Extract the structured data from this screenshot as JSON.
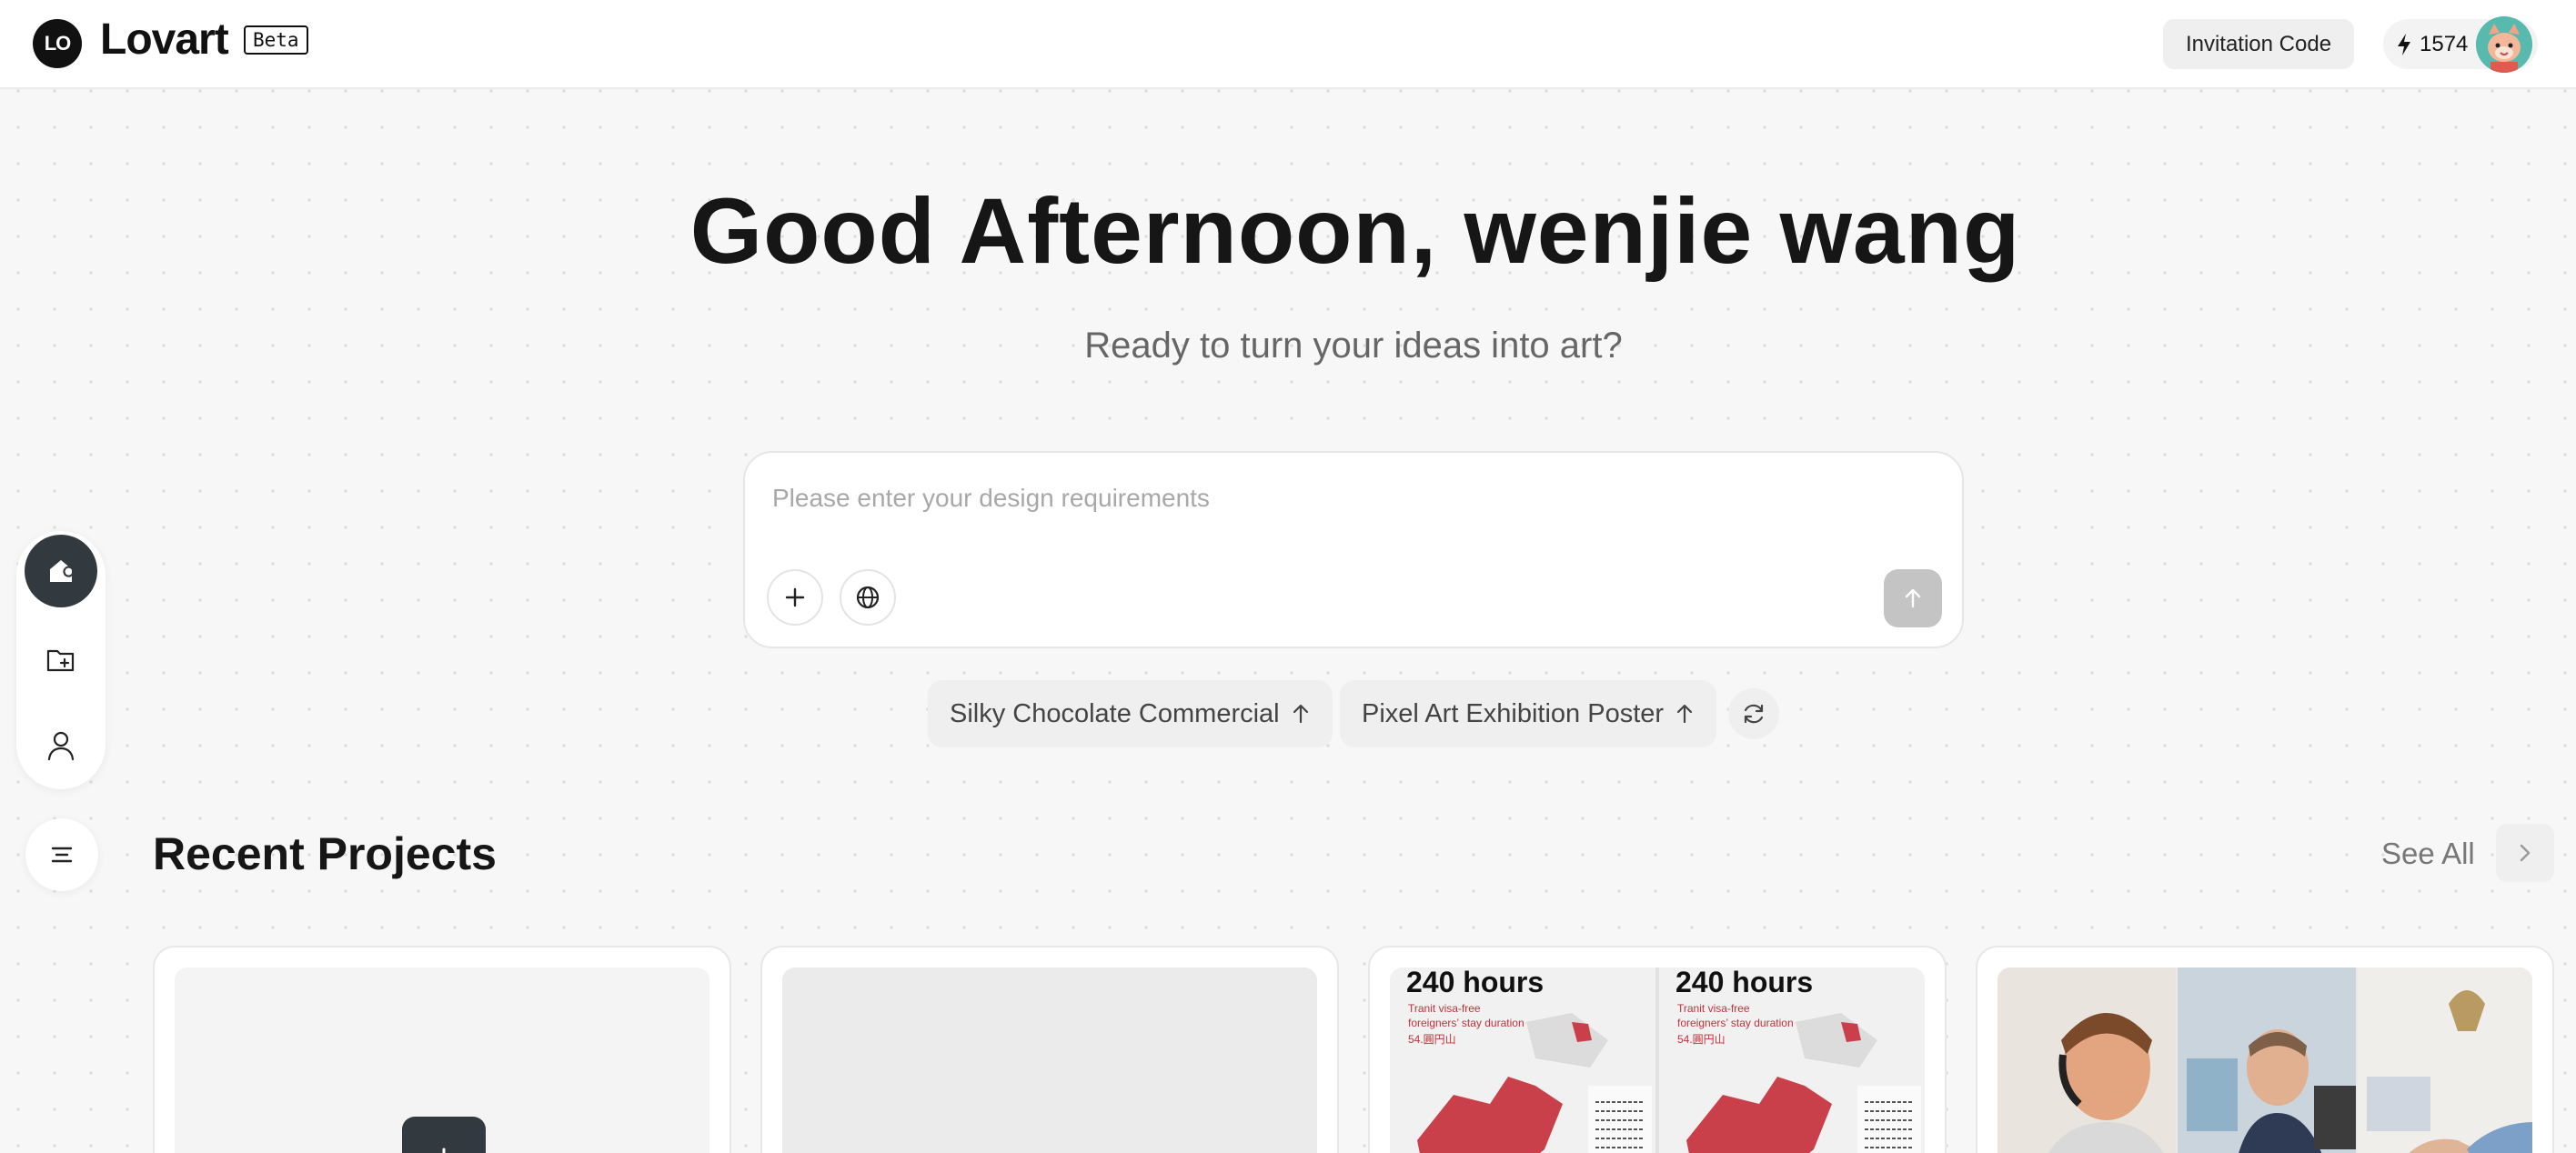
{
  "header": {
    "logo_mark": "LO",
    "brand": "Lovart",
    "beta_badge": "Beta",
    "invitation_button": "Invitation Code",
    "credits": "1574"
  },
  "hero": {
    "greeting": "Good Afternoon, wenjie wang",
    "subtitle": "Ready to turn your ideas into art?"
  },
  "prompt": {
    "placeholder": "Please enter your design requirements",
    "value": ""
  },
  "suggestions": [
    {
      "label": "Silky Chocolate Commercial"
    },
    {
      "label": "Pixel Art Exhibition Poster"
    }
  ],
  "sidebar": {
    "items": [
      {
        "name": "home",
        "active": true
      },
      {
        "name": "projects",
        "active": false
      },
      {
        "name": "profile",
        "active": false
      }
    ]
  },
  "recent": {
    "title": "Recent Projects",
    "see_all": "See All",
    "cards": [
      {
        "kind": "new-project"
      },
      {
        "kind": "placeholder"
      },
      {
        "kind": "poster",
        "poster_title": "240 hours",
        "poster_line1": "Tranit visa-free",
        "poster_line2": "foreigners’ stay duration",
        "poster_line3": "54.圓円山"
      },
      {
        "kind": "photos"
      }
    ]
  },
  "colors": {
    "accent_dark": "#333a3f",
    "send_disabled": "#c4c4c4",
    "map_red": "#c9404b",
    "avatar_bg": "#58b9ae"
  }
}
